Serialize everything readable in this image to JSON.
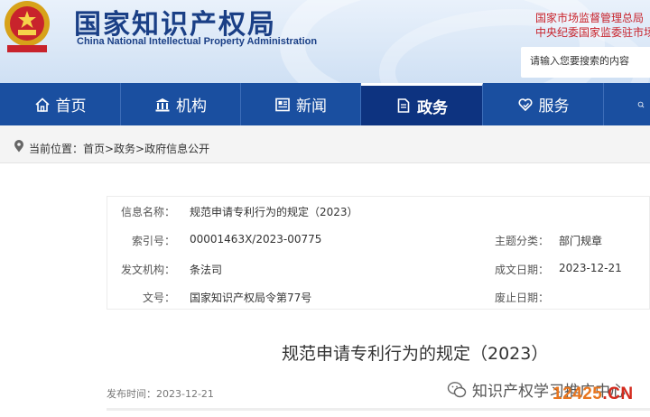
{
  "header": {
    "site_name_cn": "国家知识产权局",
    "site_name_en": "China National Intellectual Property Administration",
    "top_link_1": "国家市场监督管理总局",
    "top_link_2": "中央纪委国家监委驻市场",
    "search_placeholder": "请输入您要搜索的内容"
  },
  "nav": {
    "items": [
      {
        "label": "首页",
        "icon": "home-icon"
      },
      {
        "label": "机构",
        "icon": "building-icon"
      },
      {
        "label": "新闻",
        "icon": "news-icon"
      },
      {
        "label": "政务",
        "icon": "document-icon",
        "active": true
      },
      {
        "label": "服务",
        "icon": "heart-hand-icon"
      }
    ]
  },
  "breadcrumb": {
    "text": "当前位置：首页>政务>政府信息公开"
  },
  "info": {
    "name_label": "信息名称：",
    "name_value": "规范申请专利行为的规定（2023）",
    "index_label": "索引号：",
    "index_value": "00001463X/2023-00775",
    "topic_label": "主题分类：",
    "topic_value": "部门规章",
    "agency_label": "发文机构：",
    "agency_value": "条法司",
    "date_label": "成文日期：",
    "date_value": "2023-12-21",
    "docno_label": "文号：",
    "docno_value": "国家知识产权局令第77号",
    "expire_label": "废止日期：",
    "expire_value": ""
  },
  "document": {
    "title": "规范申请专利行为的规定（2023）",
    "publish_date": "发布时间：2023-12-21"
  },
  "watermark": {
    "text": "知识产权学习推广中心",
    "logo_orange": "12425",
    "logo_red": ".CN"
  },
  "colors": {
    "nav_bg": "#1a4fa0",
    "nav_active": "#0d3380",
    "brand_blue": "#1a3f86",
    "link_red": "#c8232c"
  }
}
